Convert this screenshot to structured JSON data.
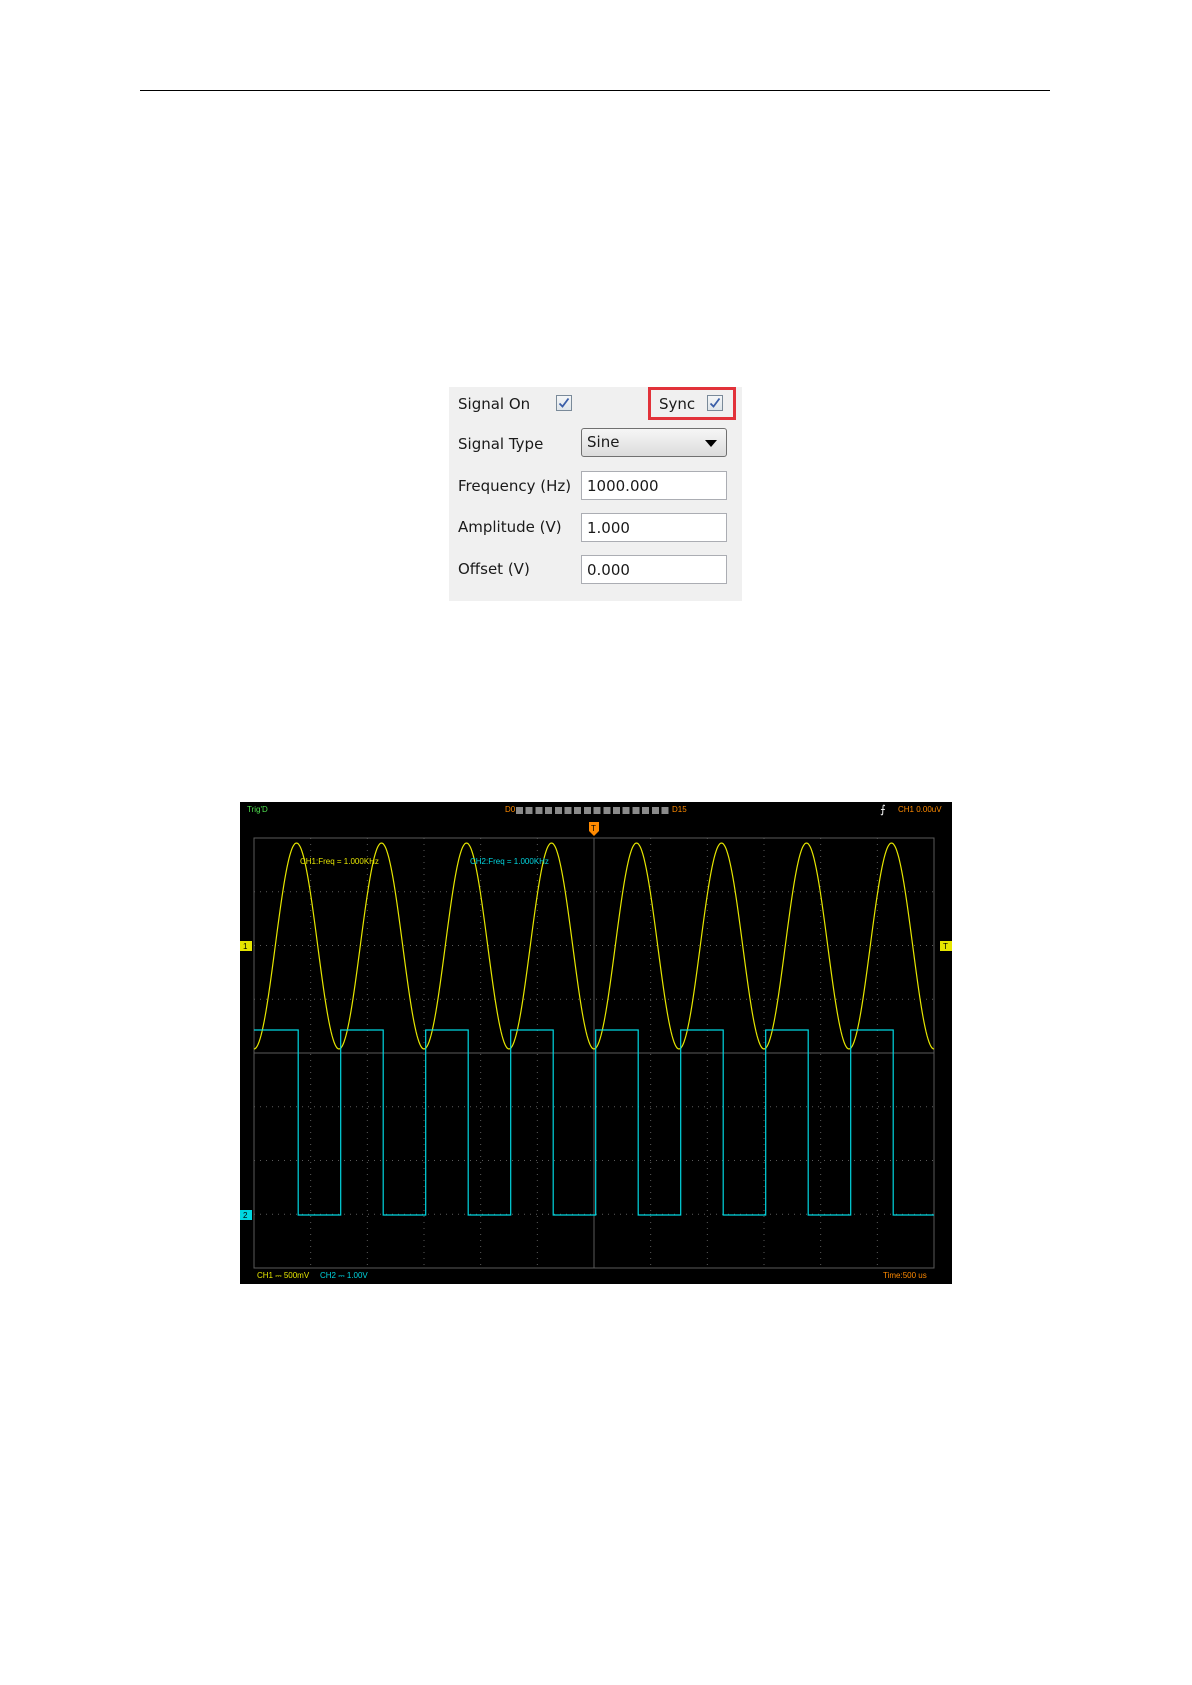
{
  "signal_panel": {
    "signal_on": {
      "label": "Signal On",
      "checked": true
    },
    "sync": {
      "label": "Sync",
      "checked": true,
      "highlight_color": "#e2323a"
    },
    "signal_type": {
      "label": "Signal Type",
      "value": "Sine"
    },
    "frequency": {
      "label": "Frequency (Hz)",
      "value": "1000.000"
    },
    "amplitude": {
      "label": "Amplitude (V)",
      "value": "1.000"
    },
    "offset": {
      "label": "Offset (V)",
      "value": "0.000"
    }
  },
  "scope": {
    "trig_status": "Trig'D",
    "trigger_info": "CH1 0.00uV",
    "ch1_measure": "CH1:Freq = 1.000KHz",
    "ch2_measure": "CH2:Freq = 1.000KHz",
    "ch1_scale": "CH1 ⎓ 500mV",
    "ch2_scale": "CH2 ⎓ 1.00V",
    "timebase": "Time:500 us",
    "ch1_marker": "1",
    "ch2_marker": "2",
    "trigger_level_marker": "T",
    "trigger_position_marker": "T",
    "memory_bar_left": "D0",
    "memory_bar_right": "D15",
    "colors": {
      "ch1": "#e6e600",
      "ch2": "#00d6e0",
      "info": "#ff8a00",
      "status": "#4fe04f",
      "grid": "#5a5a5a"
    }
  }
}
